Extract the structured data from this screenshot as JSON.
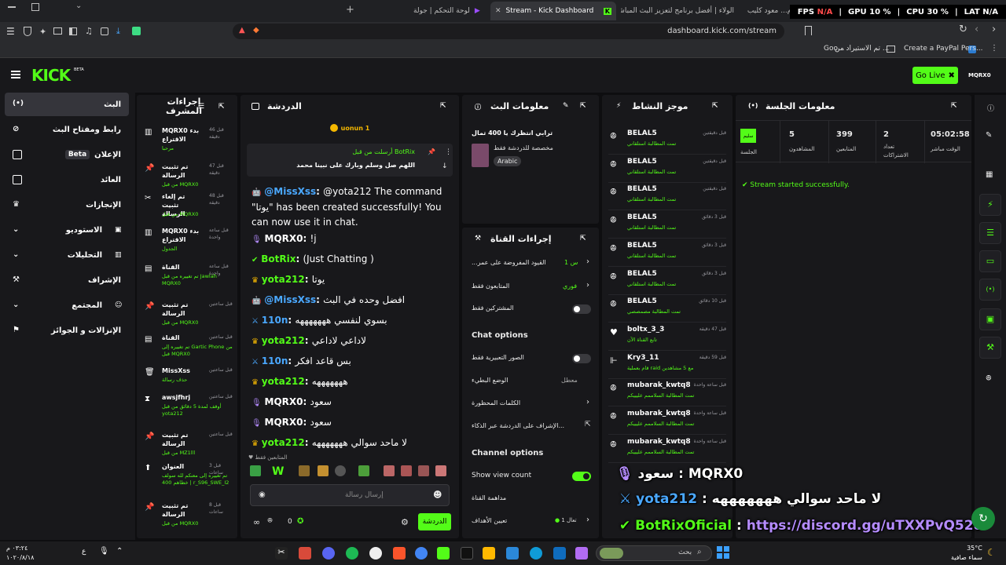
{
  "browser": {
    "tabs": [
      {
        "label": "لوحة التحكم | جولة"
      },
      {
        "label": "Stream - Kick Dashboard"
      },
      {
        "label": "الولاء | أفضل برنامج لتعزيز البث المباشر"
      },
      {
        "label": "ودايني الزم... معود كليب باعني وراح الرماس"
      }
    ],
    "url": "dashboard.kick.com/stream",
    "bookmarks": [
      "تم الاستيراد من ...",
      "Create a PayPal Pers...",
      "Goo..."
    ]
  },
  "overlay_stats": {
    "fps_label": "FPS",
    "fps": "N/A",
    "gpu_label": "GPU",
    "gpu": "10 %",
    "cpu_label": "CPU",
    "cpu": "30 %",
    "lat_label": "LAT",
    "lat": "N/A"
  },
  "app": {
    "logo": "KICK",
    "logo_badge": "BETA",
    "go_live": "Go Live",
    "user": "MQRX0",
    "colors": {
      "brand": "#53fc18",
      "bg": "#0e0e10",
      "panel": "#18181b"
    }
  },
  "sidebar": {
    "items": [
      {
        "label": "البث",
        "icon": "broadcast-icon"
      },
      {
        "label": "رابط ومفتاح البث",
        "icon": "link-icon"
      },
      {
        "label": "الإعلان",
        "icon": "ad-icon",
        "badge": "Beta"
      },
      {
        "label": "العائد",
        "icon": "wallet-icon"
      },
      {
        "label": "الإنجازات",
        "icon": "trophy-icon"
      },
      {
        "label": "الاستوديو",
        "icon": "studio-icon"
      },
      {
        "label": "التحليلات",
        "icon": "chart-icon"
      },
      {
        "label": "الإشراف",
        "icon": "gavel-icon"
      },
      {
        "label": "المجتمع",
        "icon": "community-icon"
      },
      {
        "label": "الإنزالات و الجوائز",
        "icon": "gift-icon"
      }
    ]
  },
  "mod_actions": {
    "title": "إجراءات المشرف",
    "items": [
      {
        "title": "MQRX0 بدء الاقتراع",
        "time": "قبل 46 دقيقة",
        "sub": "مرحبا"
      },
      {
        "title": "تم تثبيت الرسالة",
        "time": "قبل 47 دقيقة",
        "sub": "من قبل MQRX0"
      },
      {
        "title": "تم إلغاء تثبيت الرسالة",
        "time": "قبل 48 دقيقة",
        "sub": "من قبل MQRX0"
      },
      {
        "title": "MQRX0 بدء الاقتراع",
        "time": "قبل ساعة واحدة",
        "sub": "الجدول"
      },
      {
        "title": "القناة",
        "time": "قبل ساعة واحدة",
        "sub": "تم تغييره من قبل Jawlah MQRX0"
      },
      {
        "title": "تم تثبيت الرسالة",
        "time": "قبل ساعتين",
        "sub": "من قبل MQRX0"
      },
      {
        "title": "القناة",
        "time": "قبل ساعتين",
        "sub": "تم تغييره إلى Gartic Phone من قبل MQRX0"
      },
      {
        "title": "MissXss",
        "time": "قبل ساعتين",
        "sub": "حذف رسالة"
      },
      {
        "title": "awsjfhrj",
        "time": "قبل ساعتين",
        "sub": "أوقف لمدة 5 دقائق من قبل yota212"
      },
      {
        "title": "تم تثبيت الرسالة",
        "time": "قبل ساعتين",
        "sub": "من قبل MZ1lll"
      },
      {
        "title": "العنوان",
        "time": "قبل 3 ساعات",
        "sub": "تم تغييره إلى معنكم لله سولف خطاهم 400 | r_S96_SWE_I2"
      },
      {
        "title": "تم تثبيت الرسالة",
        "time": "قبل 8 ساعات",
        "sub": "من قبل MQRX0"
      }
    ]
  },
  "chat": {
    "title": "الدردشة",
    "pinned_user": "uonun 1",
    "pinned_by": "أرسلت من قبل BotRix",
    "pinned_text": "اللهم صل وسلم وبارك على نبينا محمد",
    "messages": [
      {
        "user": "@MissXss",
        "text": "@yota212 The command \"يوتا\" has been created successfully! You can now use it in chat."
      },
      {
        "user": "MQRX0",
        "text": "!j"
      },
      {
        "user": "BotRix",
        "text": "(Just Chatting )"
      },
      {
        "user": "yota212",
        "text": "يوتا"
      },
      {
        "user": "@MissXss",
        "text": "افضل وحده في البث"
      },
      {
        "user": "110n",
        "text": "بسوي لنفسي هههههههه"
      },
      {
        "user": "yota212",
        "text": "لاداعي لاداعي"
      },
      {
        "user": "110n",
        "text": "بس قاعد افكر"
      },
      {
        "user": "yota212",
        "text": "هههههههه"
      },
      {
        "user": "MQRX0",
        "text": "سعود"
      },
      {
        "user": "MQRX0",
        "text": "سعود"
      },
      {
        "user": "yota212",
        "text": "لا ماحد سوالي هههههههه"
      }
    ],
    "followers_only": "المتابعين فقط",
    "input_placeholder": "إرسال رسالة",
    "send": "الدردشة",
    "viewer_count": "0"
  },
  "stream_info": {
    "title": "معلومات البث",
    "stream_title": "ترابي انتظرك يا 400 تمال",
    "category": "مخصصة للدردشة فقط",
    "language": "Arabic"
  },
  "channel_actions": {
    "title": "إجراءات القناة",
    "items": [
      {
        "label": "القيود المفروضة على عمر...",
        "value": "س 1"
      },
      {
        "label": "المتابعون فقط",
        "value": "فوري"
      },
      {
        "label": "المشتركين فقط",
        "value": ""
      }
    ],
    "chat_options_title": "Chat options",
    "chat_options": [
      {
        "label": "الصور التعبيرية فقط",
        "value": ""
      },
      {
        "label": "الوضع البطيء",
        "value": "معطل"
      },
      {
        "label": "الكلمات المحظورة",
        "value": ""
      },
      {
        "label": "الإشراف على الدردشة عبر الذكاء...",
        "value": ""
      }
    ],
    "channel_options_title": "Channel options",
    "channel_options": [
      {
        "label": "Show view count",
        "value": ""
      },
      {
        "label": "مداهمة القناة",
        "value": ""
      },
      {
        "label": "تعيين الأهداف",
        "value": "تعال 1"
      }
    ]
  },
  "activity": {
    "title": "موجز النشاط",
    "items": [
      {
        "user": "BELAL5",
        "time": "قبل دقيقتين",
        "sub": "تمت المطالبة استلقاني"
      },
      {
        "user": "BELAL5",
        "time": "قبل دقيقتين",
        "sub": "تمت المطالبة استلقاني"
      },
      {
        "user": "BELAL5",
        "time": "قبل دقيقتين",
        "sub": "تمت المطالبة استلقاني"
      },
      {
        "user": "BELAL5",
        "time": "قبل 3 دقائق",
        "sub": "تمت المطالبة استلقاني"
      },
      {
        "user": "BELAL5",
        "time": "قبل 3 دقائق",
        "sub": "تمت المطالبة استلقاني"
      },
      {
        "user": "BELAL5",
        "time": "قبل 3 دقائق",
        "sub": "تمت المطالبة استلقاني"
      },
      {
        "user": "BELAL5",
        "time": "قبل 10 دقائق",
        "sub": "تمت المطالبة مصمصصي"
      },
      {
        "user": "boltx_3_3",
        "time": "قبل 47 دقيقة",
        "sub": "تابع القناة الآن"
      },
      {
        "user": "Kry3_11",
        "time": "قبل 59 دقيقة",
        "sub": "قام بعملية raid مع 5 مشاهدين"
      },
      {
        "user": "mubarak_kwtq8",
        "time": "قبل ساعة واحدة",
        "sub": "تمت المطالبة السلاممم عليييكم"
      },
      {
        "user": "mubarak_kwtq8",
        "time": "قبل ساعة واحدة",
        "sub": "تمت المطالبة السلاممم عليييكم"
      },
      {
        "user": "mubarak_kwtq8",
        "time": "قبل ساعة واحدة",
        "sub": "تمت المطالبة السلاممم عليييكم"
      }
    ]
  },
  "session": {
    "title": "معلومات الجلسة",
    "stats": [
      {
        "label": "الوقت مباشر",
        "value": "05:02:58"
      },
      {
        "label": "تعداد الاشتراكات",
        "value": "2"
      },
      {
        "label": "المتابعين",
        "value": "399"
      },
      {
        "label": "المشاهدون",
        "value": "5"
      },
      {
        "label": "الجلسة",
        "value": "سليم"
      }
    ],
    "success": "Stream started successfully."
  },
  "stream_overlay": [
    {
      "user": "MQRX0",
      "text": "سعود"
    },
    {
      "user": "yota212",
      "text": "لا ماحد سوالي هههههههه"
    },
    {
      "user": "BotRixOficial",
      "text": "https://discord.gg/uTXXPvQ528"
    }
  ],
  "taskbar": {
    "search": "بحث",
    "weather_temp": "35°C",
    "weather_desc": "سماء صافية",
    "time": "٠٣:٢٤ م",
    "date": "١٠٢٠/٨/١٨"
  }
}
